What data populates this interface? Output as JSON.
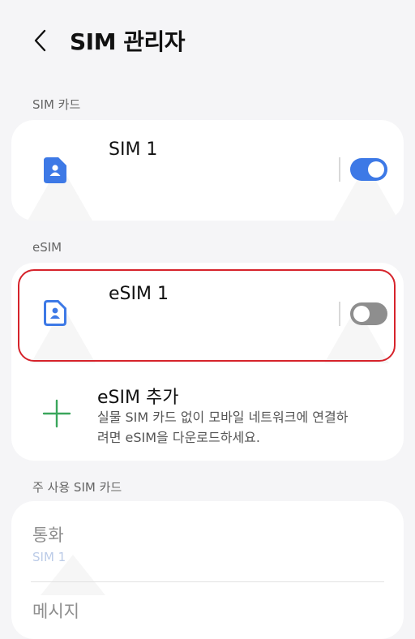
{
  "header": {
    "title": "SIM 관리자"
  },
  "sim_section": {
    "label": "SIM 카드",
    "sim1": {
      "title": "SIM 1",
      "toggle_on": true
    }
  },
  "esim_section": {
    "label": "eSIM",
    "esim1": {
      "title": "eSIM 1",
      "toggle_on": false
    },
    "add": {
      "title": "eSIM 추가",
      "description": "실물 SIM 카드 없이 모바일 네트워크에 연결하려면 eSIM을 다운로드하세요."
    }
  },
  "preferred_section": {
    "label": "주 사용 SIM 카드",
    "items": [
      {
        "title": "통화",
        "value": "SIM 1"
      },
      {
        "title": "메시지"
      }
    ]
  },
  "colors": {
    "accent": "#3d79e6",
    "highlight": "#d6232b",
    "plus_green": "#3aa65c"
  }
}
